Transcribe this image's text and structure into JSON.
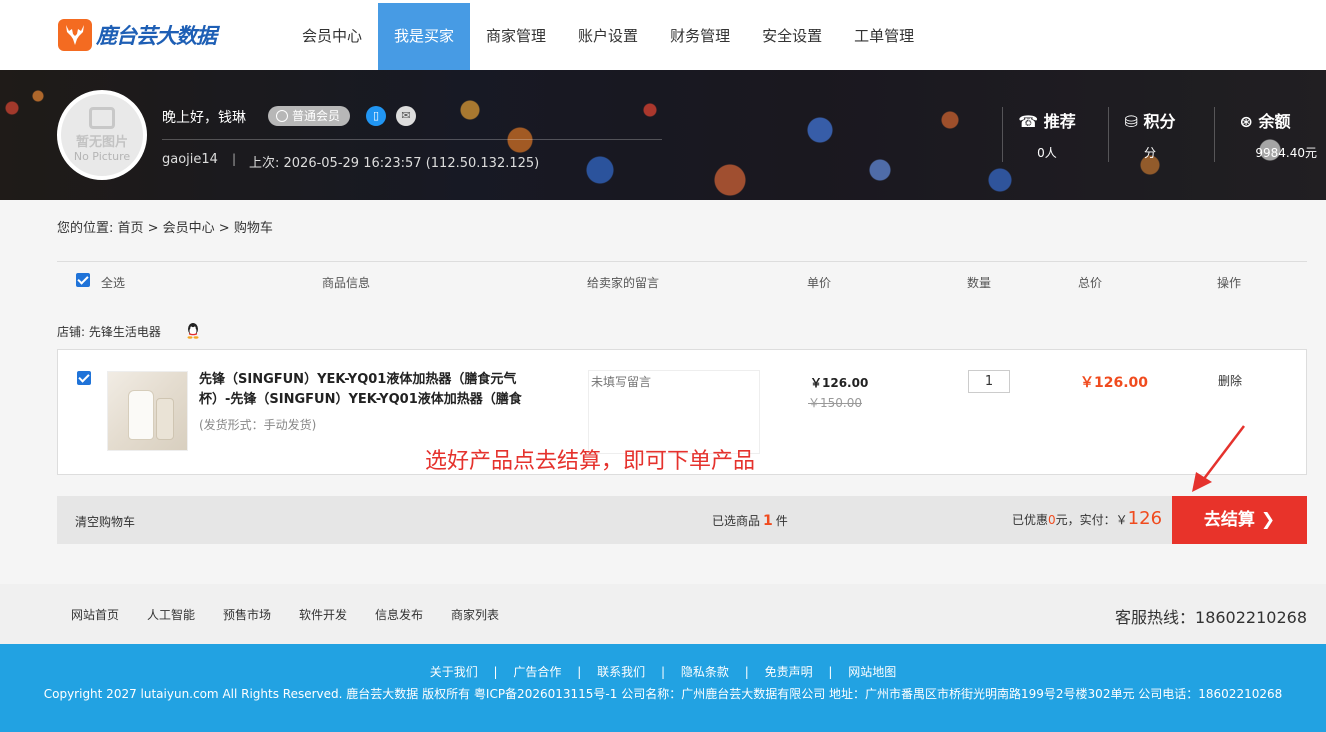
{
  "header": {
    "logo_text": "鹿台芸大数据",
    "nav": [
      {
        "label": "会员中心",
        "active": false
      },
      {
        "label": "我是买家",
        "active": true
      },
      {
        "label": "商家管理",
        "active": false
      },
      {
        "label": "账户设置",
        "active": false
      },
      {
        "label": "财务管理",
        "active": false
      },
      {
        "label": "安全设置",
        "active": false
      },
      {
        "label": "工单管理",
        "active": false
      }
    ]
  },
  "profile": {
    "avatar_text_1": "暂无图片",
    "avatar_text_2": "No Picture",
    "greeting": "晚上好，钱琳",
    "member_level": "普通会员",
    "username": "gaojie14",
    "separator": "|",
    "last_login": "上次: 2026-05-29 16:23:57 (112.50.132.125)",
    "stats": [
      {
        "icon": "phone-icon",
        "label": "推荐",
        "value": "0人"
      },
      {
        "icon": "coins-icon",
        "label": "积分",
        "value": "分"
      },
      {
        "icon": "wallet-icon",
        "label": "余额",
        "value": "9984.40元"
      }
    ]
  },
  "breadcrumb": "您的位置: 首页 > 会员中心 > 购物车",
  "cart": {
    "columns": {
      "select_all": "全选",
      "product": "商品信息",
      "message": "给卖家的留言",
      "unit_price": "单价",
      "quantity": "数量",
      "total": "总价",
      "action": "操作"
    },
    "shop_name": "店铺: 先锋生活电器",
    "item": {
      "title": "先锋（SINGFUN）YEK-YQ01液体加热器（膳食元气杯）-先锋（SINGFUN）YEK-YQ01液体加热器（膳食",
      "shipping": "(发货形式：手动发货)",
      "message_placeholder": "未填写留言",
      "price_now": "￥126.00",
      "price_old": "￥150.00",
      "quantity": "1",
      "total": "￥126.00",
      "delete_label": "删除"
    },
    "annotation": "选好产品点去结算，即可下单产品",
    "footer": {
      "clear_label": "清空购物车",
      "selected_prefix": "已选商品",
      "selected_count": "1",
      "selected_suffix": "件",
      "discount_prefix": "已优惠",
      "discount_value": "0",
      "discount_suffix": "元，实付：￥",
      "pay_amount": "126",
      "checkout_label": "去结算"
    }
  },
  "footer": {
    "links": [
      "网站首页",
      "人工智能",
      "预售市场",
      "软件开发",
      "信息发布",
      "商家列表"
    ],
    "hotline": "客服热线：18602210268",
    "bottom_links": [
      "关于我们",
      "广告合作",
      "联系我们",
      "隐私条款",
      "免责声明",
      "网站地图"
    ],
    "link_separator": "|",
    "copyright": "Copyright 2027 lutaiyun.com All Rights Reserved. 鹿台芸大数据  版权所有  粤ICP备2026013115号-1 公司名称：广州鹿台芸大数据有限公司  地址：广州市番禺区市桥街光明南路199号2号楼302单元 公司电话：18602210268"
  },
  "colors": {
    "nav_active": "#479be4",
    "accent_red": "#e8332a",
    "price_orange": "#f04b1e",
    "footer_blue": "#22a2e2"
  }
}
